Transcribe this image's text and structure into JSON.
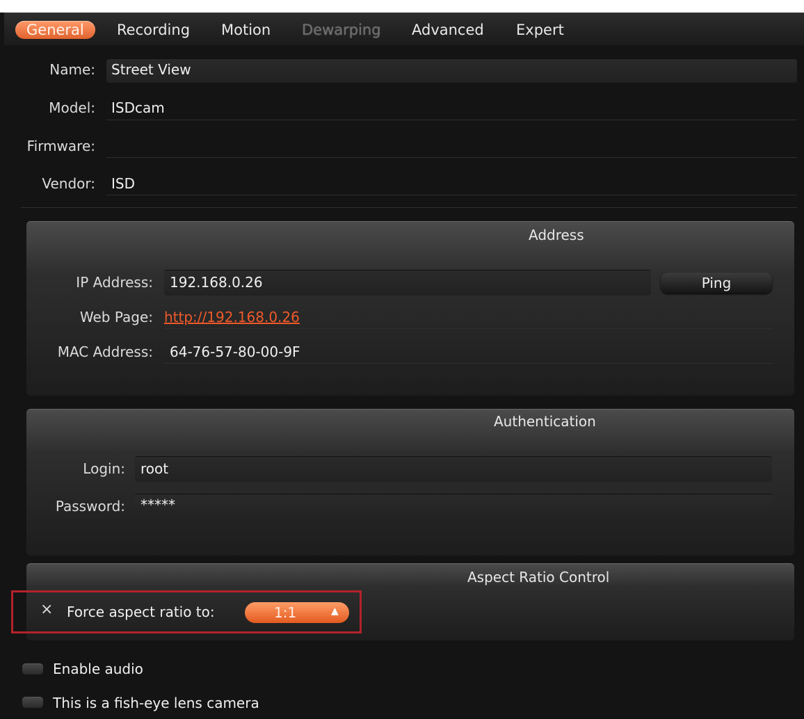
{
  "tabs": [
    {
      "label": "General",
      "state": "active"
    },
    {
      "label": "Recording",
      "state": "normal"
    },
    {
      "label": "Motion",
      "state": "normal"
    },
    {
      "label": "Dewarping",
      "state": "disabled"
    },
    {
      "label": "Advanced",
      "state": "normal"
    },
    {
      "label": "Expert",
      "state": "normal"
    }
  ],
  "info": {
    "name_label": "Name:",
    "name_value": "Street View",
    "model_label": "Model:",
    "model_value": "ISDcam",
    "firmware_label": "Firmware:",
    "firmware_value": "",
    "vendor_label": "Vendor:",
    "vendor_value": "ISD"
  },
  "address": {
    "title": "Address",
    "ip_label": "IP Address:",
    "ip_value": "192.168.0.26",
    "ping_label": "Ping",
    "webpage_label": "Web Page:",
    "webpage_value": "http://192.168.0.26",
    "mac_label": "MAC Address:",
    "mac_value": "64-76-57-80-00-9F"
  },
  "auth": {
    "title": "Authentication",
    "login_label": "Login:",
    "login_value": "root",
    "password_label": "Password:",
    "password_value": "*****"
  },
  "aspect": {
    "title": "Aspect Ratio Control",
    "checkbox_mark": "×",
    "force_label": "Force aspect ratio to:",
    "ratio_value": "1:1"
  },
  "options": {
    "audio_label": "Enable audio",
    "fisheye_label": "This is a fish-eye lens camera"
  },
  "colors": {
    "accent": "#e8672f",
    "link": "#f05a2a",
    "highlight_border": "#b3222a",
    "background": "#141414"
  }
}
